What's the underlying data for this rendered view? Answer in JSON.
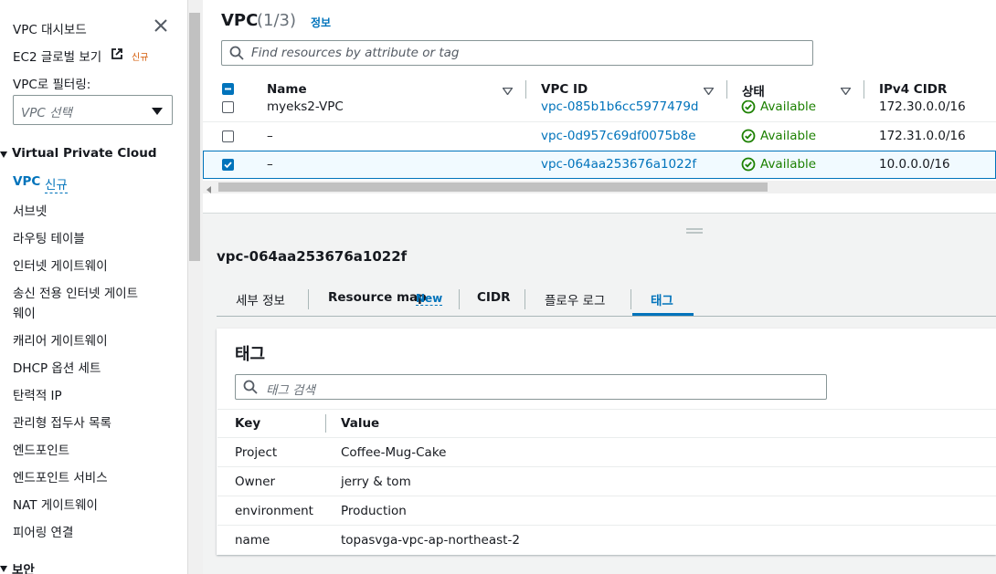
{
  "sidebar": {
    "dashboard": "VPC 대시보드",
    "ec2_global_view": "EC2 글로벌 보기",
    "ec2_new_badge": "신규",
    "filter_label": "VPC로 필터링:",
    "filter_placeholder": "VPC 선택",
    "section_title": "Virtual Private Cloud",
    "vpc_item": "VPC",
    "vpc_new_badge": "신규",
    "items": [
      "서브넷",
      "라우팅 테이블",
      "인터넷 게이트웨이",
      "송신 전용 인터넷 게이트",
      "웨이",
      "캐리어 게이트웨이",
      "DHCP 옵션 세트",
      "탄력적 IP",
      "관리형 접두사 목록",
      "엔드포인트",
      "엔드포인트 서비스",
      "NAT 게이트웨이",
      "피어링 연결"
    ],
    "security_section": "보안"
  },
  "header": {
    "title": "VPC",
    "count": "(1/3)",
    "info_link": "정보",
    "search_placeholder": "Find resources by attribute or tag"
  },
  "table": {
    "columns": [
      "Name",
      "VPC ID",
      "상태",
      "IPv4 CIDR"
    ],
    "rows": [
      {
        "name": "myeks2-VPC",
        "vpc_id": "vpc-085b1b6cc5977479d",
        "status": "Available",
        "cidr": "172.30.0.0/16",
        "checked": false
      },
      {
        "name": "–",
        "vpc_id": "vpc-0d957c69df0075b8e",
        "status": "Available",
        "cidr": "172.31.0.0/16",
        "checked": false
      },
      {
        "name": "–",
        "vpc_id": "vpc-064aa253676a1022f",
        "status": "Available",
        "cidr": "10.0.0.0/16",
        "checked": true
      }
    ]
  },
  "detail": {
    "title": "vpc-064aa253676a1022f",
    "tabs": [
      "세부 정보",
      "Resource map",
      "CIDR",
      "플로우 로그",
      "태그"
    ],
    "tab_new_badge": "New",
    "active_tab": "태그",
    "tags_heading": "태그",
    "tags_search_placeholder": "태그 검색",
    "tag_columns": [
      "Key",
      "Value"
    ],
    "tags": [
      {
        "key": "Project",
        "value": "Coffee-Mug-Cake"
      },
      {
        "key": "Owner",
        "value": "jerry & tom"
      },
      {
        "key": "environment",
        "value": "Production"
      },
      {
        "key": "name",
        "value": "topasvga-vpc-ap-northeast-2"
      }
    ]
  },
  "colors": {
    "link": "#0073bb",
    "available": "#1d8102",
    "selected_row": "#f1faff"
  }
}
